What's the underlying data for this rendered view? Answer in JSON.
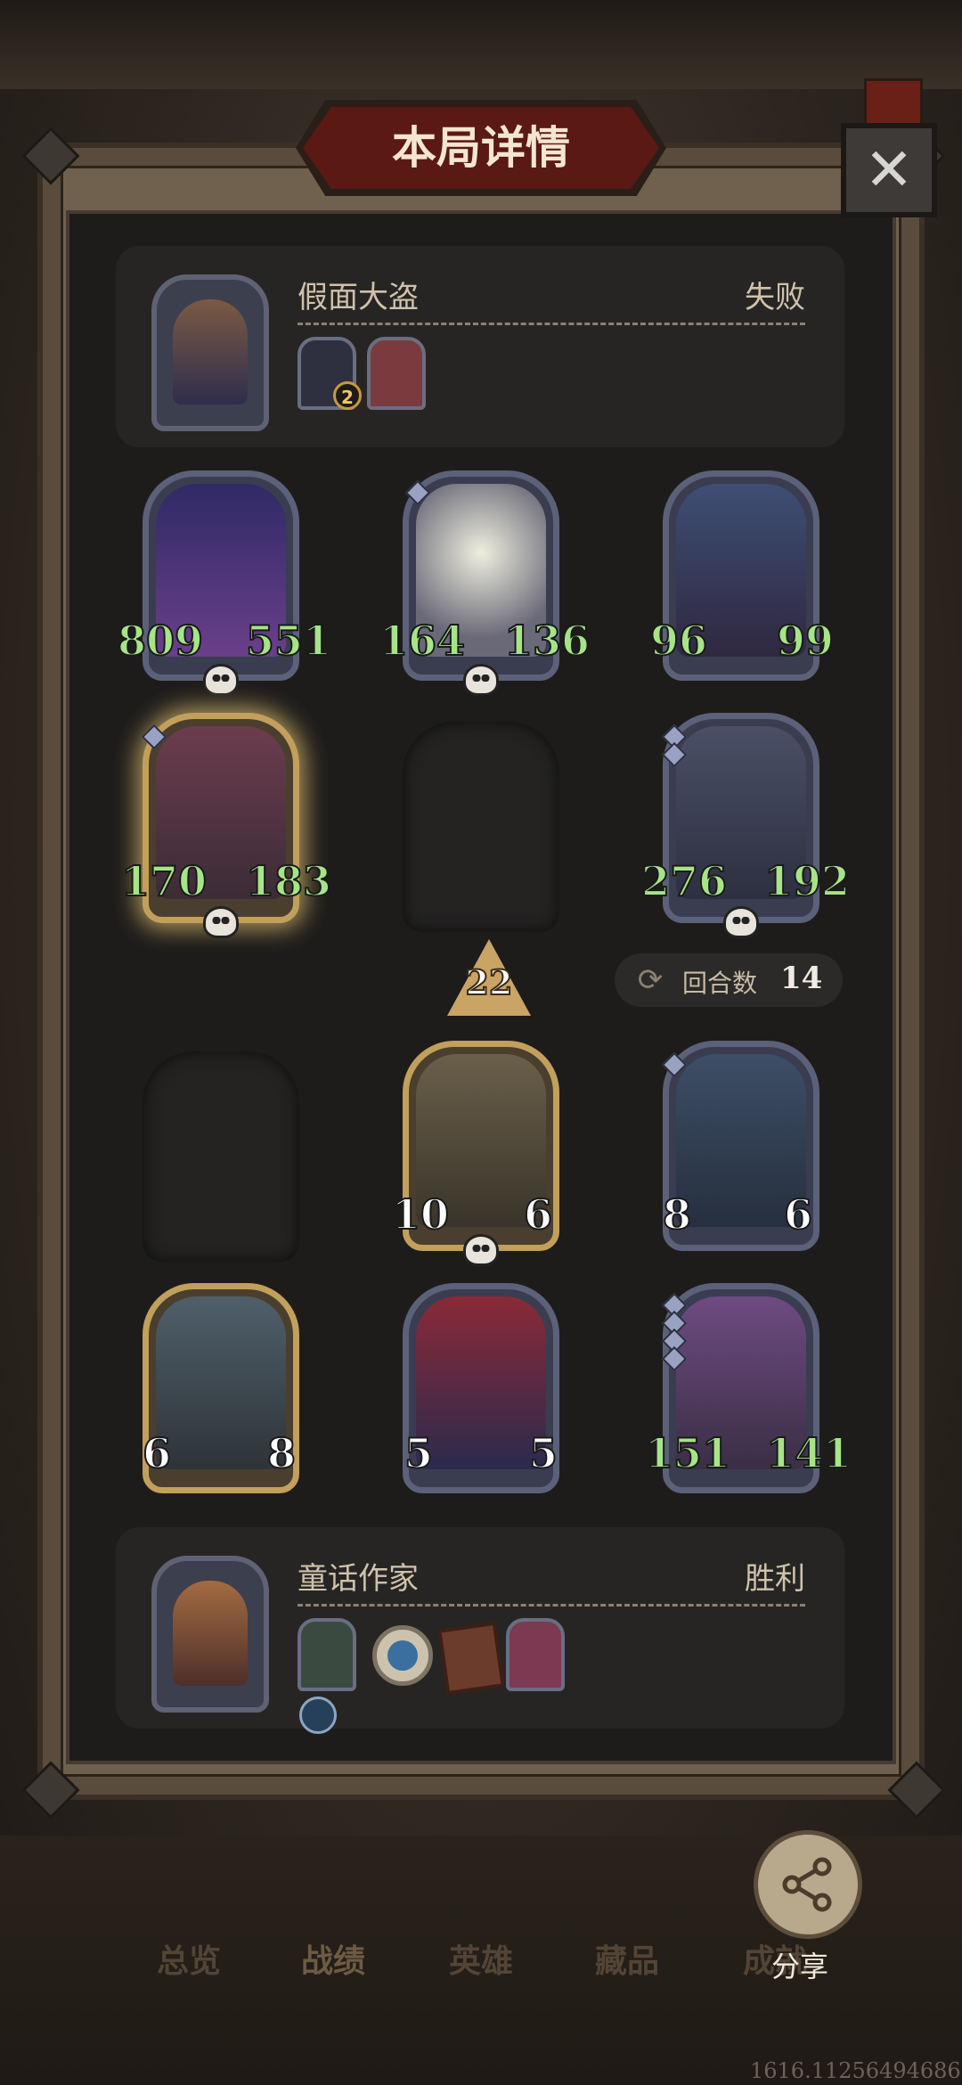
{
  "title": "本局详情",
  "opponent": {
    "name": "假面大盗",
    "result": "失败",
    "item_badge": "2"
  },
  "player": {
    "name": "童话作家",
    "result": "胜利"
  },
  "opponent_board": [
    {
      "atk": "809",
      "hp": "551"
    },
    {
      "atk": "164",
      "hp": "136"
    },
    {
      "atk": "96",
      "hp": "99"
    },
    {
      "atk": "170",
      "hp": "183"
    },
    {
      "atk": "276",
      "hp": "192"
    }
  ],
  "player_board": [
    {
      "atk": "10",
      "hp": "6"
    },
    {
      "atk": "8",
      "hp": "6"
    },
    {
      "atk": "6",
      "hp": "8"
    },
    {
      "atk": "5",
      "hp": "5"
    },
    {
      "atk": "151",
      "hp": "141"
    }
  ],
  "tier": "22",
  "rounds": {
    "label": "回合数",
    "value": "14"
  },
  "nav": {
    "tabs": [
      "总览",
      "战绩",
      "英雄",
      "藏品",
      "成就"
    ]
  },
  "share_label": "分享",
  "build_id": "1616.11256494686",
  "icons": [
    "close-icon",
    "skull-icon",
    "refresh-icon",
    "share-icon"
  ]
}
